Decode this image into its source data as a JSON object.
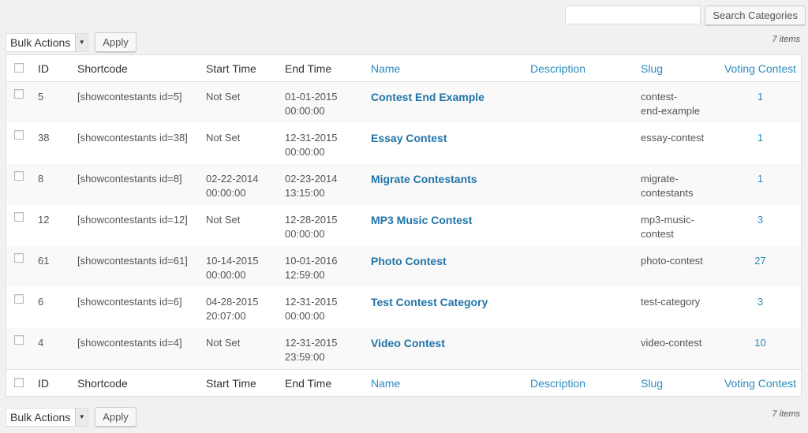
{
  "search": {
    "placeholder": "",
    "button_label": "Search Categories"
  },
  "tablenav": {
    "bulk_actions_label": "Bulk Actions",
    "apply_label": "Apply",
    "items_count": "7 items"
  },
  "columns": [
    "ID",
    "Shortcode",
    "Start Time",
    "End Time",
    "Name",
    "Description",
    "Slug",
    "Voting Contest"
  ],
  "rows": [
    {
      "id": "5",
      "shortcode": "[showcontestants id=5]",
      "start": [
        "Not Set",
        ""
      ],
      "end": [
        "01-01-2015",
        "00:00:00"
      ],
      "name": "Contest End Example",
      "description": "",
      "slug": [
        "contest-",
        "end-example"
      ],
      "voting": "1"
    },
    {
      "id": "38",
      "shortcode": "[showcontestants id=38]",
      "start": [
        "Not Set",
        ""
      ],
      "end": [
        "12-31-2015",
        "00:00:00"
      ],
      "name": "Essay Contest",
      "description": "",
      "slug": [
        "essay-contest",
        ""
      ],
      "voting": "1"
    },
    {
      "id": "8",
      "shortcode": "[showcontestants id=8]",
      "start": [
        "02-22-2014",
        "00:00:00"
      ],
      "end": [
        "02-23-2014",
        "13:15:00"
      ],
      "name": "Migrate Contestants",
      "description": "",
      "slug": [
        "migrate-",
        "contestants"
      ],
      "voting": "1"
    },
    {
      "id": "12",
      "shortcode": "[showcontestants id=12]",
      "start": [
        "Not Set",
        ""
      ],
      "end": [
        "12-28-2015",
        "00:00:00"
      ],
      "name": "MP3 Music Contest",
      "description": "",
      "slug": [
        "mp3-music-",
        "contest"
      ],
      "voting": "3"
    },
    {
      "id": "61",
      "shortcode": "[showcontestants id=61]",
      "start": [
        "10-14-2015",
        "00:00:00"
      ],
      "end": [
        "10-01-2016",
        "12:59:00"
      ],
      "name": "Photo Contest",
      "description": "",
      "slug": [
        "photo-contest",
        ""
      ],
      "voting": "27"
    },
    {
      "id": "6",
      "shortcode": "[showcontestants id=6]",
      "start": [
        "04-28-2015",
        "20:07:00"
      ],
      "end": [
        "12-31-2015",
        "00:00:00"
      ],
      "name": "Test Contest Category",
      "description": "",
      "slug": [
        "test-category",
        ""
      ],
      "voting": "3"
    },
    {
      "id": "4",
      "shortcode": "[showcontestants id=4]",
      "start": [
        "Not Set",
        ""
      ],
      "end": [
        "12-31-2015",
        "23:59:00"
      ],
      "name": "Video Contest",
      "description": "",
      "slug": [
        "video-contest",
        ""
      ],
      "voting": "10"
    }
  ],
  "colors": {
    "link": "#2a8bbd",
    "name_link": "#2174a8",
    "background": "#f1f1f1"
  },
  "icons": {
    "dropdown": "chevron-down-icon"
  }
}
